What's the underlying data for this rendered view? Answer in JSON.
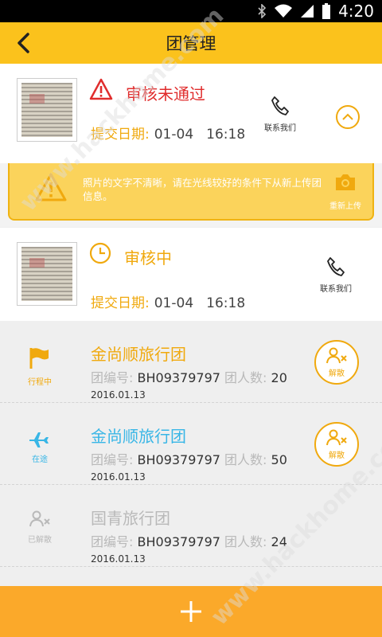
{
  "status_bar": {
    "time": "4:20"
  },
  "app_bar": {
    "title": "团管理"
  },
  "pending_rejected": {
    "status": "审核未通过",
    "date_label": "提交日期:",
    "date": "01-04",
    "time": "16:18",
    "contact_label": "联系我们"
  },
  "notice": {
    "message": "照片的文字不清晰，请在光线较好的条件下从新上传团信息。",
    "reupload_label": "重新上传"
  },
  "pending_review": {
    "status": "审核中",
    "date_label": "提交日期:",
    "date": "01-04",
    "time": "16:18",
    "contact_label": "联系我们"
  },
  "groups": [
    {
      "status": "行程中",
      "name": "金尚顺旅行团",
      "code_label": "团编号:",
      "code": "BH09379797",
      "count_label": "团人数:",
      "count": "20",
      "date": "2016.01.13",
      "action": "解散",
      "color": "#f0a90e"
    },
    {
      "status": "在途",
      "name": "金尚顺旅行团",
      "code_label": "团编号:",
      "code": "BH09379797",
      "count_label": "团人数:",
      "count": "50",
      "date": "2016.01.13",
      "action": "解散",
      "color": "#38b6e6"
    },
    {
      "status": "已解散",
      "name": "国青旅行团",
      "code_label": "团编号:",
      "code": "BH09379797",
      "count_label": "团人数:",
      "count": "24",
      "date": "2016.01.13",
      "action": "",
      "color": "#b9b9b9"
    }
  ],
  "watermark": "www.hackhome.com",
  "colors": {
    "accent": "#fbc21c",
    "orange": "#f0a90e",
    "red": "#e02d2d",
    "blue": "#38b6e6",
    "bottom": "#fba92a"
  }
}
